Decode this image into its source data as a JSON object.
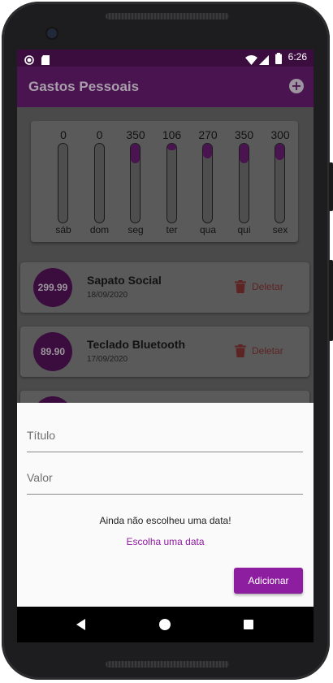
{
  "status_bar": {
    "time": "6:26"
  },
  "app_bar": {
    "title": "Gastos Pessoais",
    "add_icon": "add-circle-icon"
  },
  "chart_data": {
    "type": "bar",
    "categories": [
      "sáb",
      "dom",
      "seg",
      "ter",
      "qua",
      "qui",
      "sex"
    ],
    "amount_labels": [
      "0",
      "0",
      "350",
      "106",
      "270",
      "350",
      "300"
    ],
    "values": [
      0,
      0,
      350.0,
      106.0,
      270.0,
      350.0,
      300.0
    ],
    "fill_fraction": [
      0,
      0,
      0.25,
      0.08,
      0.19,
      0.25,
      0.21
    ]
  },
  "transactions": [
    {
      "value": "299.99",
      "title": "Sapato Social",
      "date": "18/09/2020",
      "delete_label": "Deletar"
    },
    {
      "value": "89.90",
      "title": "Teclado Bluetooth",
      "date": "17/09/2020",
      "delete_label": "Deletar"
    }
  ],
  "form": {
    "title_placeholder": "Título",
    "value_placeholder": "Valor",
    "no_date_text": "Ainda não escolheu uma data!",
    "choose_date_label": "Escolha uma data",
    "submit_label": "Adicionar"
  },
  "colors": {
    "primary": "#8e1ea0",
    "status_bar": "#3b0d3f"
  }
}
